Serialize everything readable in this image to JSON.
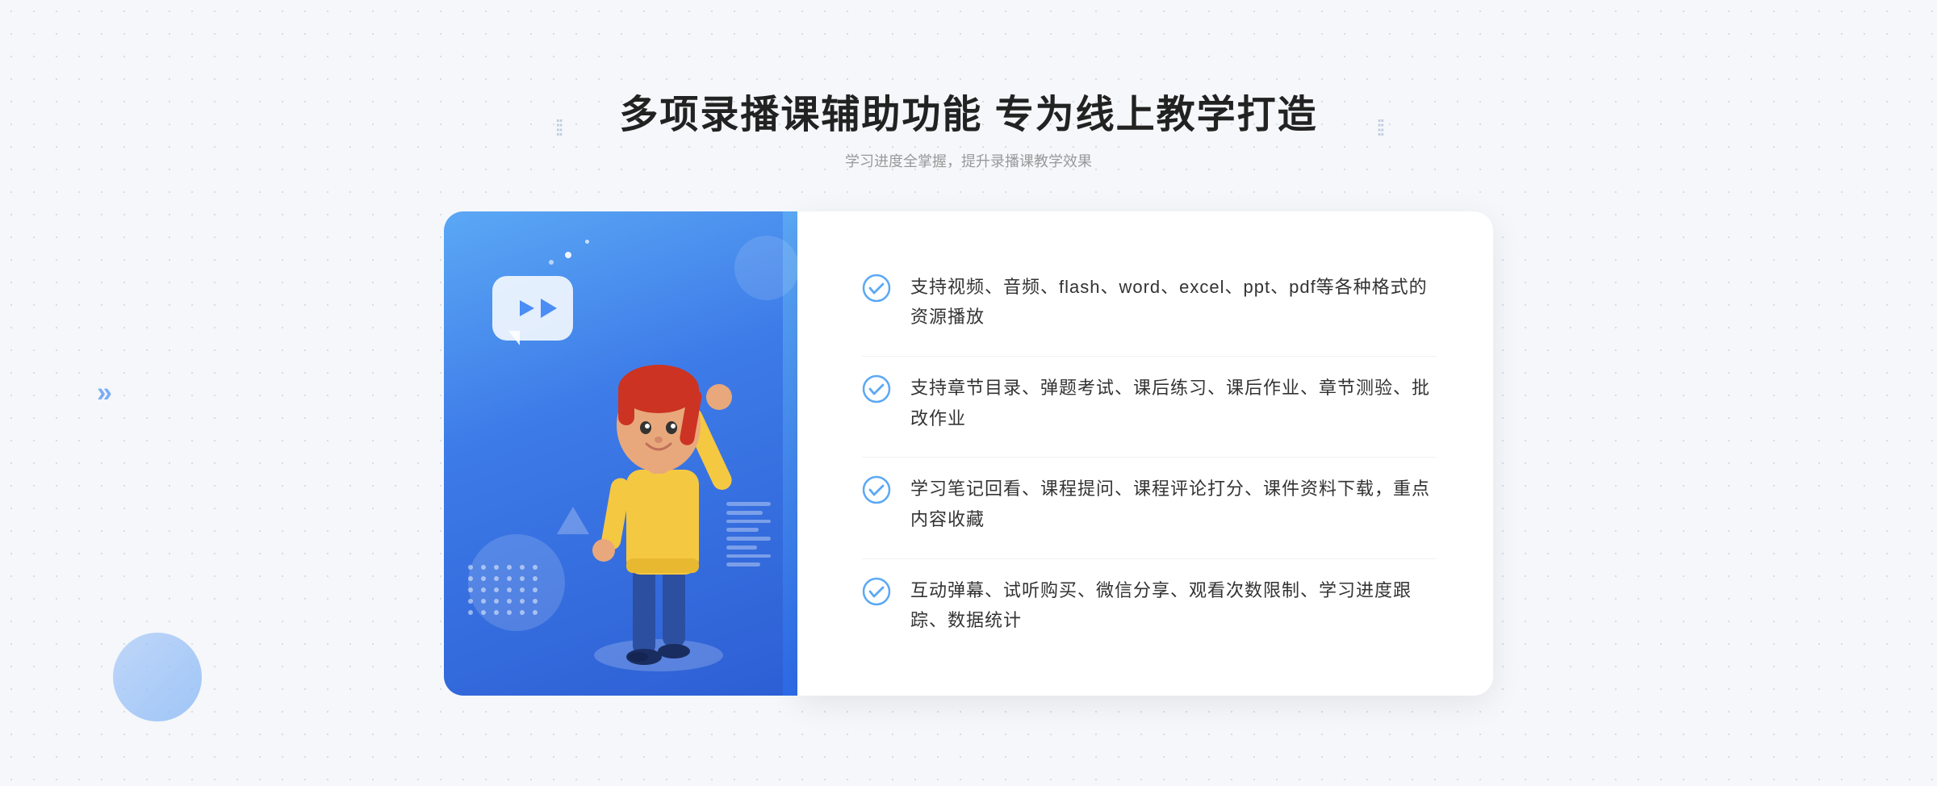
{
  "header": {
    "title": "多项录播课辅助功能 专为线上教学打造",
    "subtitle": "学习进度全掌握，提升录播课教学效果",
    "deco_dots_label": "⁞⁞"
  },
  "features": [
    {
      "id": 1,
      "text": "支持视频、音频、flash、word、excel、ppt、pdf等各种格式的资源播放"
    },
    {
      "id": 2,
      "text": "支持章节目录、弹题考试、课后练习、课后作业、章节测验、批改作业"
    },
    {
      "id": 3,
      "text": "学习笔记回看、课程提问、课程评论打分、课件资料下载，重点内容收藏"
    },
    {
      "id": 4,
      "text": "互动弹幕、试听购买、微信分享、观看次数限制、学习进度跟踪、数据统计"
    }
  ],
  "colors": {
    "blue_primary": "#3d7be8",
    "blue_light": "#5ba8f5",
    "check_color": "#5ba8f5",
    "title_color": "#222222",
    "subtitle_color": "#999999",
    "text_color": "#333333"
  }
}
